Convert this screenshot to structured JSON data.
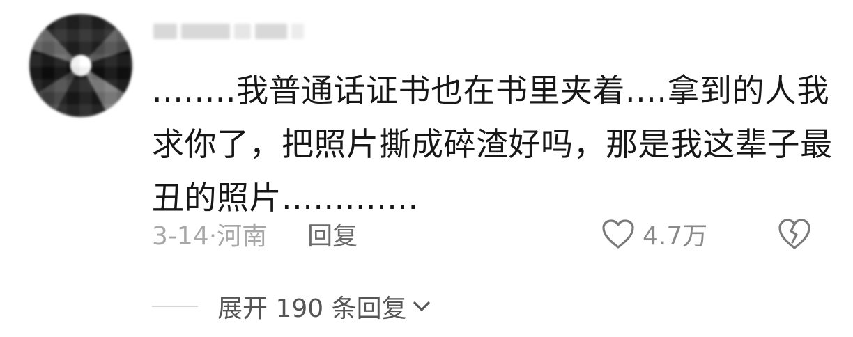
{
  "comment": {
    "avatar_icon": "blurred-avatar-icon",
    "username": "",
    "text": "........我普通话证书也在书里夹着....拿到的人我求你了，把照片撕成碎渣好吗，那是我这辈子最丑的照片.............",
    "date_location": "3-14·河南",
    "reply_label": "回复",
    "like_icon": "heart-outline-icon",
    "like_count": "4.7万",
    "dislike_icon": "broken-heart-icon",
    "expand_label": "展开 190 条回复",
    "expand_icon": "chevron-down-icon"
  },
  "colors": {
    "text_primary": "#171717",
    "text_meta": "#a8a8a8",
    "icon_gray": "#777777"
  }
}
